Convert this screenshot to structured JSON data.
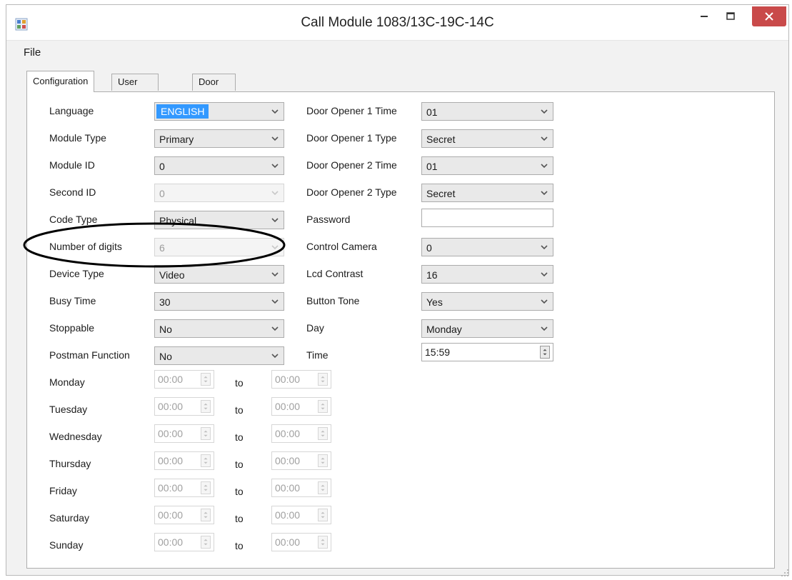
{
  "window": {
    "title": "Call Module 1083/13C-19C-14C"
  },
  "menu": {
    "file": "File"
  },
  "tabs": [
    "Configuration",
    "User Records",
    "Door Opener Codes"
  ],
  "left_fields": [
    {
      "label": "Language",
      "value": "ENGLISH"
    },
    {
      "label": "Module Type",
      "value": "Primary"
    },
    {
      "label": "Module ID",
      "value": "0"
    },
    {
      "label": "Second ID",
      "value": "0"
    },
    {
      "label": "Code Type",
      "value": "Physical"
    },
    {
      "label": "Number of digits",
      "value": "6"
    },
    {
      "label": "Device Type",
      "value": "Video"
    },
    {
      "label": "Busy Time",
      "value": "30"
    },
    {
      "label": "Stoppable",
      "value": "No"
    },
    {
      "label": "Postman Function",
      "value": "No"
    }
  ],
  "right_fields": [
    {
      "label": "Door Opener 1 Time",
      "value": "01"
    },
    {
      "label": "Door Opener 1 Type",
      "value": "Secret"
    },
    {
      "label": "Door Opener 2 Time",
      "value": "01"
    },
    {
      "label": "Door Opener 2 Type",
      "value": "Secret"
    },
    {
      "label": "Password",
      "value": ""
    },
    {
      "label": "Control Camera",
      "value": "0"
    },
    {
      "label": "Lcd Contrast",
      "value": "16"
    },
    {
      "label": "Button Tone",
      "value": "Yes"
    },
    {
      "label": "Day",
      "value": "Monday"
    },
    {
      "label": "Time",
      "value": "15:59"
    }
  ],
  "schedule": {
    "to_label": "to",
    "days": [
      {
        "day": "Monday",
        "from": "00:00",
        "to": "00:00"
      },
      {
        "day": "Tuesday",
        "from": "00:00",
        "to": "00:00"
      },
      {
        "day": "Wednesday",
        "from": "00:00",
        "to": "00:00"
      },
      {
        "day": "Thursday",
        "from": "00:00",
        "to": "00:00"
      },
      {
        "day": "Friday",
        "from": "00:00",
        "to": "00:00"
      },
      {
        "day": "Saturday",
        "from": "00:00",
        "to": "00:00"
      },
      {
        "day": "Sunday",
        "from": "00:00",
        "to": "00:00"
      }
    ]
  },
  "colors": {
    "selection": "#3399ff",
    "close_button": "#c94a4a",
    "annotation": "#000000"
  }
}
